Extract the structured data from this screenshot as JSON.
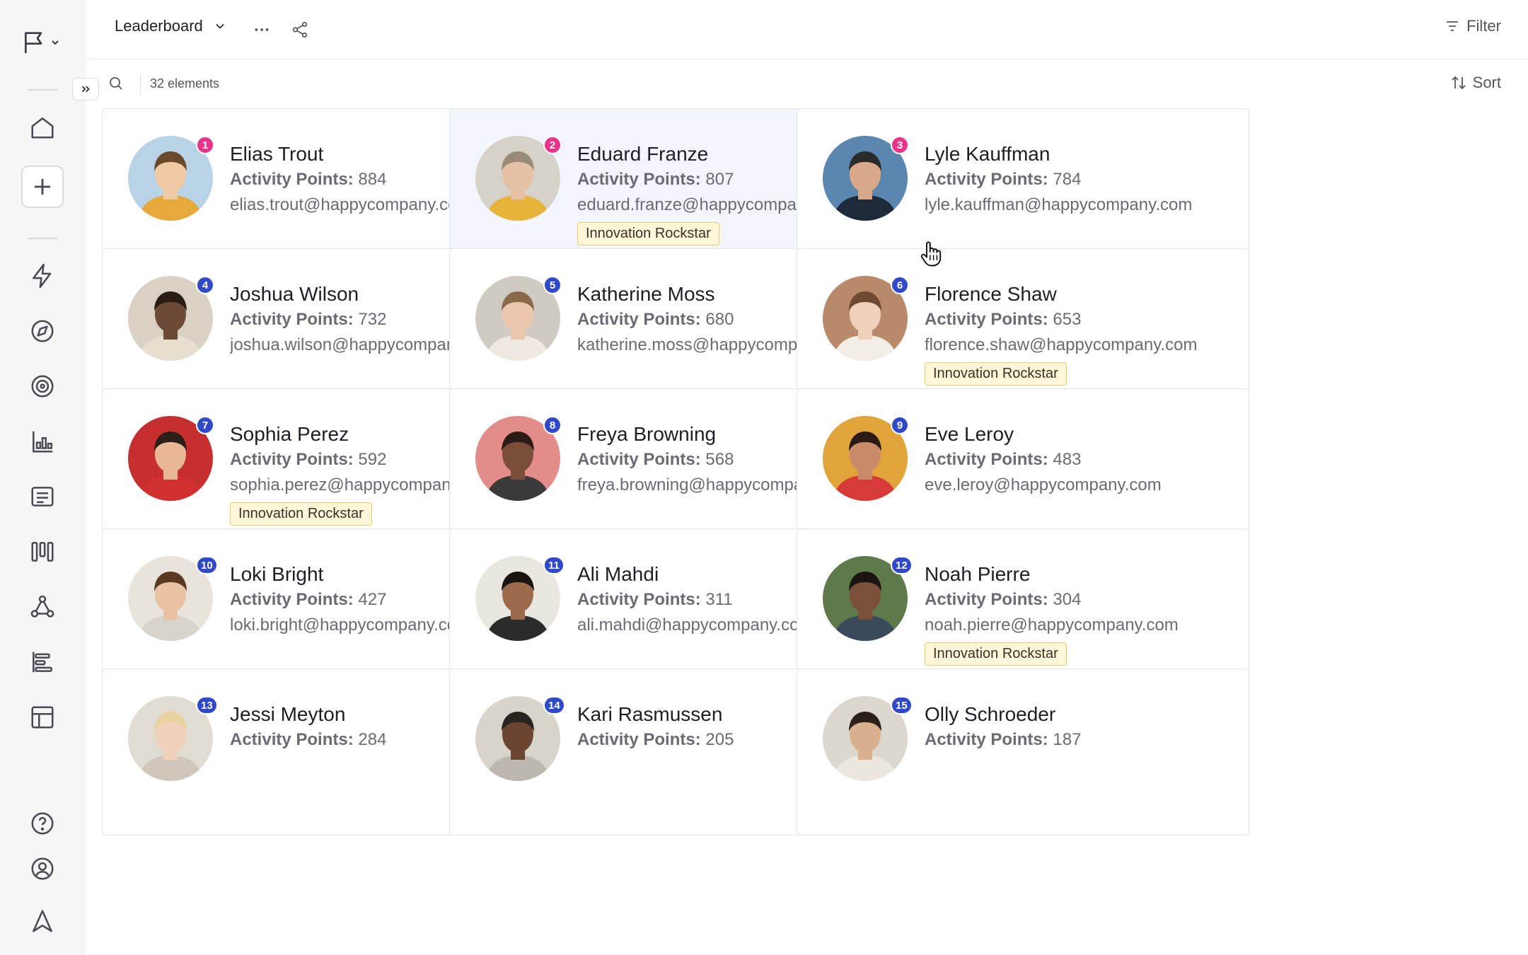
{
  "app": {
    "title": "Leaderboard"
  },
  "toolbar": {
    "view_name": "Leaderboard",
    "filter_label": "Filter",
    "sort_label": "Sort",
    "count_text": "32 elements"
  },
  "sidebar": {
    "items": [
      {
        "icon": "flag-icon"
      },
      {
        "icon": "home-icon"
      },
      {
        "icon": "plus-icon"
      },
      {
        "icon": "lightning-icon"
      },
      {
        "icon": "compass-icon"
      },
      {
        "icon": "target-icon"
      },
      {
        "icon": "chart-icon"
      },
      {
        "icon": "list-icon"
      },
      {
        "icon": "board-icon"
      },
      {
        "icon": "network-icon"
      },
      {
        "icon": "timeline-icon"
      },
      {
        "icon": "layout-icon"
      },
      {
        "icon": "help-icon"
      },
      {
        "icon": "user-icon"
      },
      {
        "icon": "triangle-icon"
      }
    ]
  },
  "points_label": "Activity Points:",
  "badge_label": "Innovation Rockstar",
  "cards": [
    {
      "rank": "1",
      "name": "Elias Trout",
      "points": "884",
      "email": "elias.trout@happycompany.com",
      "badge": false
    },
    {
      "rank": "2",
      "name": "Eduard Franze",
      "points": "807",
      "email": "eduard.franze@happycompany.com",
      "badge": true
    },
    {
      "rank": "3",
      "name": "Lyle Kauffman",
      "points": "784",
      "email": "lyle.kauffman@happycompany.com",
      "badge": false
    },
    {
      "rank": "4",
      "name": "Joshua Wilson",
      "points": "732",
      "email": "joshua.wilson@happycompany.com",
      "badge": false
    },
    {
      "rank": "5",
      "name": "Katherine Moss",
      "points": "680",
      "email": "katherine.moss@happycompany.co...",
      "badge": false
    },
    {
      "rank": "6",
      "name": "Florence Shaw",
      "points": "653",
      "email": "florence.shaw@happycompany.com",
      "badge": true
    },
    {
      "rank": "7",
      "name": "Sophia Perez",
      "points": "592",
      "email": "sophia.perez@happycompany.com",
      "badge": true
    },
    {
      "rank": "8",
      "name": "Freya Browning",
      "points": "568",
      "email": "freya.browning@happycompany.com",
      "badge": false
    },
    {
      "rank": "9",
      "name": "Eve Leroy",
      "points": "483",
      "email": "eve.leroy@happycompany.com",
      "badge": false
    },
    {
      "rank": "10",
      "name": "Loki Bright",
      "points": "427",
      "email": "loki.bright@happycompany.com",
      "badge": false
    },
    {
      "rank": "11",
      "name": "Ali Mahdi",
      "points": "311",
      "email": "ali.mahdi@happycompany.com",
      "badge": false
    },
    {
      "rank": "12",
      "name": "Noah Pierre",
      "points": "304",
      "email": "noah.pierre@happycompany.com",
      "badge": true
    },
    {
      "rank": "13",
      "name": "Jessi Meyton",
      "points": "284",
      "email": "",
      "badge": false
    },
    {
      "rank": "14",
      "name": "Kari Rasmussen",
      "points": "205",
      "email": "",
      "badge": false
    },
    {
      "rank": "15",
      "name": "Olly Schroeder",
      "points": "187",
      "email": "",
      "badge": false
    }
  ],
  "colors": {
    "rank_top": "#e8348c",
    "rank_rest": "#2f49c9",
    "badge_bg": "#fdf6d8",
    "badge_border": "#e8cf6a",
    "hover_card": "#f2f6fc"
  }
}
